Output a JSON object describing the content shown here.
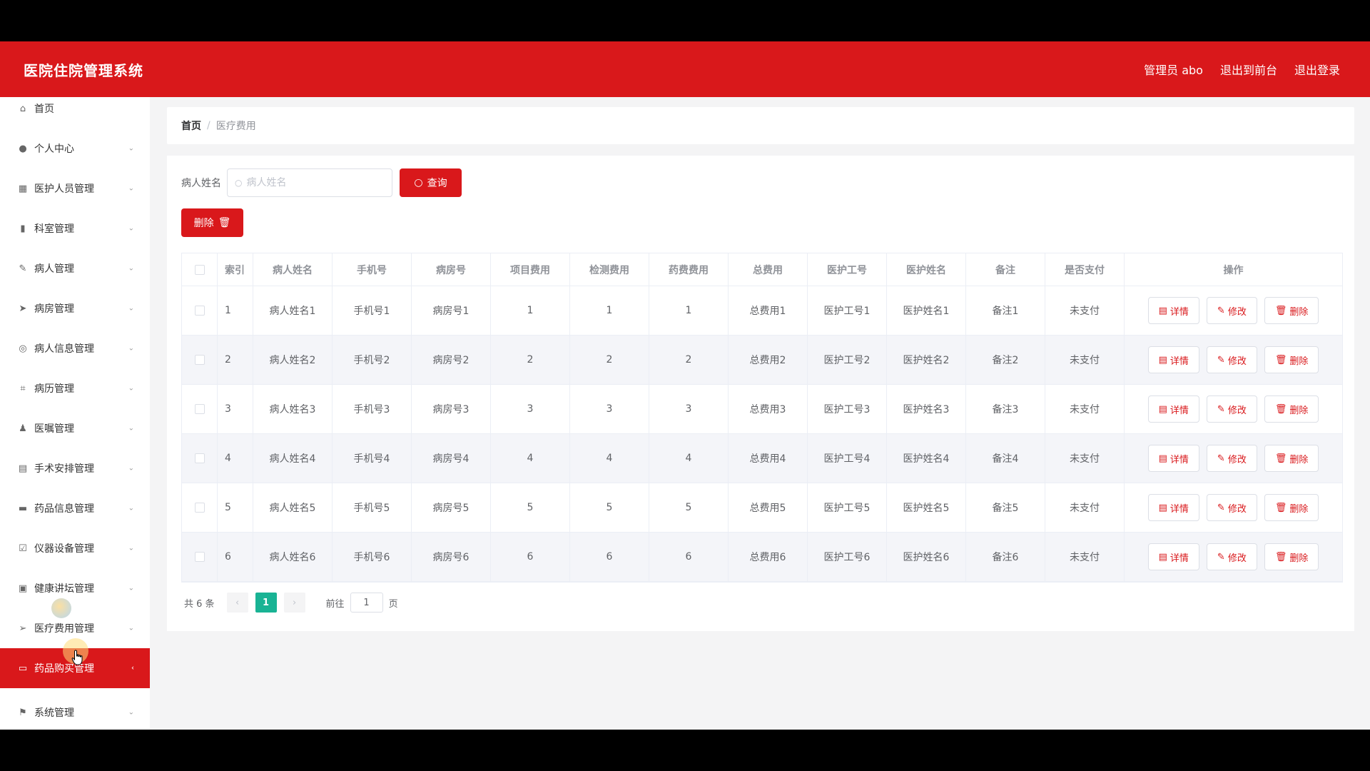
{
  "header": {
    "app_title": "医院住院管理系统",
    "admin_label": "管理员 abo",
    "back_to_front": "退出到前台",
    "logout": "退出登录"
  },
  "sidebar": {
    "items": [
      {
        "label": "首页",
        "icon": "home-icon"
      },
      {
        "label": "个人中心",
        "icon": "user-icon"
      },
      {
        "label": "医护人员管理",
        "icon": "grid-icon"
      },
      {
        "label": "科室管理",
        "icon": "bar-chart-icon"
      },
      {
        "label": "病人管理",
        "icon": "edit-icon"
      },
      {
        "label": "病房管理",
        "icon": "send-icon"
      },
      {
        "label": "病人信息管理",
        "icon": "compass-icon"
      },
      {
        "label": "病历管理",
        "icon": "crop-icon"
      },
      {
        "label": "医嘱管理",
        "icon": "person-icon"
      },
      {
        "label": "手术安排管理",
        "icon": "chart-icon"
      },
      {
        "label": "药品信息管理",
        "icon": "printer-icon"
      },
      {
        "label": "仪器设备管理",
        "icon": "clipboard-icon"
      },
      {
        "label": "健康讲坛管理",
        "icon": "briefcase-icon"
      },
      {
        "label": "医疗费用管理",
        "icon": "location-icon"
      },
      {
        "label": "药品购买管理",
        "icon": "message-icon"
      },
      {
        "label": "系统管理",
        "icon": "flag-icon"
      }
    ]
  },
  "breadcrumb": {
    "home": "首页",
    "separator": "/",
    "current": "医疗费用"
  },
  "search": {
    "label": "病人姓名",
    "placeholder": "病人姓名",
    "button_label": "查询"
  },
  "toolbar": {
    "delete_label": "删除"
  },
  "table": {
    "headers": [
      "索引",
      "病人姓名",
      "手机号",
      "病房号",
      "项目费用",
      "检测费用",
      "药费费用",
      "总费用",
      "医护工号",
      "医护姓名",
      "备注",
      "是否支付",
      "操作"
    ],
    "rows": [
      [
        "1",
        "病人姓名1",
        "手机号1",
        "病房号1",
        "1",
        "1",
        "1",
        "总费用1",
        "医护工号1",
        "医护姓名1",
        "备注1",
        "未支付"
      ],
      [
        "2",
        "病人姓名2",
        "手机号2",
        "病房号2",
        "2",
        "2",
        "2",
        "总费用2",
        "医护工号2",
        "医护姓名2",
        "备注2",
        "未支付"
      ],
      [
        "3",
        "病人姓名3",
        "手机号3",
        "病房号3",
        "3",
        "3",
        "3",
        "总费用3",
        "医护工号3",
        "医护姓名3",
        "备注3",
        "未支付"
      ],
      [
        "4",
        "病人姓名4",
        "手机号4",
        "病房号4",
        "4",
        "4",
        "4",
        "总费用4",
        "医护工号4",
        "医护姓名4",
        "备注4",
        "未支付"
      ],
      [
        "5",
        "病人姓名5",
        "手机号5",
        "病房号5",
        "5",
        "5",
        "5",
        "总费用5",
        "医护工号5",
        "医护姓名5",
        "备注5",
        "未支付"
      ],
      [
        "6",
        "病人姓名6",
        "手机号6",
        "病房号6",
        "6",
        "6",
        "6",
        "总费用6",
        "医护工号6",
        "医护姓名6",
        "备注6",
        "未支付"
      ]
    ],
    "ops": {
      "detail": "详情",
      "edit": "修改",
      "delete": "删除"
    }
  },
  "pagination": {
    "total": "共 6 条",
    "prev": "‹",
    "current_page": "1",
    "next": "›",
    "goto_label": "前往",
    "goto_value": "1",
    "page_suffix": "页"
  },
  "colors": {
    "brand": "#d9181b",
    "page_active": "#19b394"
  }
}
